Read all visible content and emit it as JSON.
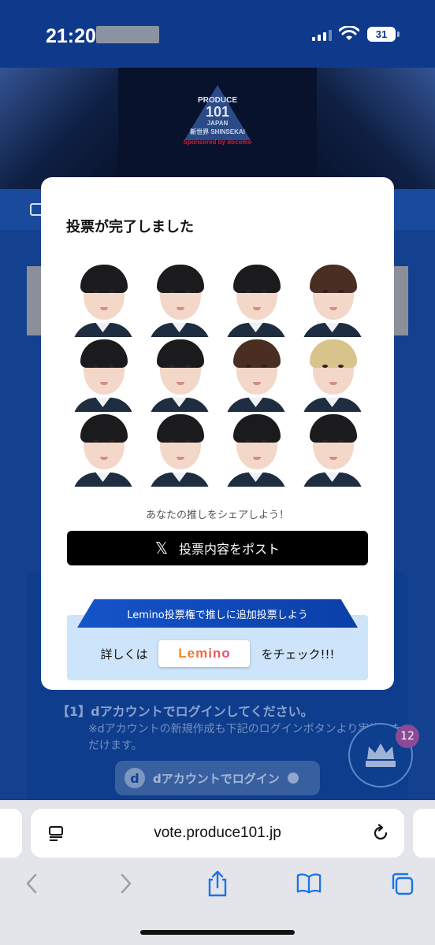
{
  "status_bar": {
    "time": "21:20",
    "battery": "31"
  },
  "banner": {
    "logo_top": "PRODUCE",
    "logo_number": "101",
    "logo_japan": "JAPAN",
    "logo_series": "新世界 SHINSEKAI",
    "sponsor": "Sponsored by docomo"
  },
  "background_page": {
    "login_step": "【1】dアカウントでログインしてください。",
    "login_note": "※dアカウントの新規作成も下記のログインボタンより実施いただけます。",
    "login_button": "dアカウントでログイン",
    "d_letter": "d",
    "badge_count": "12"
  },
  "modal": {
    "title": "投票が完了しました",
    "portraits": [
      {
        "hair": "black"
      },
      {
        "hair": "black"
      },
      {
        "hair": "black"
      },
      {
        "hair": "brown"
      },
      {
        "hair": "black"
      },
      {
        "hair": "black"
      },
      {
        "hair": "brown"
      },
      {
        "hair": "blonde"
      },
      {
        "hair": "black"
      },
      {
        "hair": "black"
      },
      {
        "hair": "black"
      },
      {
        "hair": "black"
      }
    ],
    "share_hint": "あなたの推しをシェアしよう！",
    "post_button": "投票内容をポスト",
    "x_glyph": "𝕏",
    "lemino_ribbon": "Lemino投票権で推しに追加投票しよう",
    "check_pre": "詳しくは",
    "lemino_logo": "Lemino",
    "check_post": "をチェック!!!"
  },
  "browser": {
    "url": "vote.produce101.jp",
    "toolbar": [
      "back-icon",
      "forward-icon",
      "share-icon",
      "bookmarks-icon",
      "tabs-icon"
    ]
  },
  "colors": {
    "page_blue": "#14418f",
    "status_blue": "#0f3a8c",
    "ribbon_blue": "#1554c9",
    "lemino_box": "#cde4fb",
    "ios_blue": "#1a73e8"
  }
}
